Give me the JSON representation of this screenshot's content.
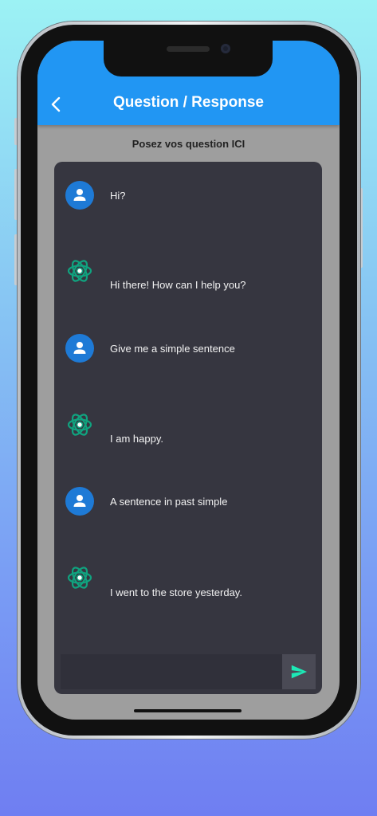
{
  "app": {
    "title": "Question / Response",
    "subtitle": "Posez vos question ICI"
  },
  "icons": {
    "back": "chevron-left-icon",
    "user": "person-icon",
    "bot": "openai-logo-icon",
    "send": "send-icon"
  },
  "colors": {
    "appbar": "#2196f3",
    "chat_panel": "#363640",
    "user_avatar": "#1e7ad6",
    "bot_logo": "#10a37f",
    "send_icon": "#1de9b6"
  },
  "messages": [
    {
      "role": "user",
      "text": "Hi?"
    },
    {
      "role": "bot",
      "text": "Hi there! How can I help you?"
    },
    {
      "role": "user",
      "text": "Give me a simple sentence"
    },
    {
      "role": "bot",
      "text": "I am happy."
    },
    {
      "role": "user",
      "text": "A sentence in past simple"
    },
    {
      "role": "bot",
      "text": "I went to the store yesterday."
    }
  ],
  "input": {
    "value": "",
    "placeholder": ""
  }
}
